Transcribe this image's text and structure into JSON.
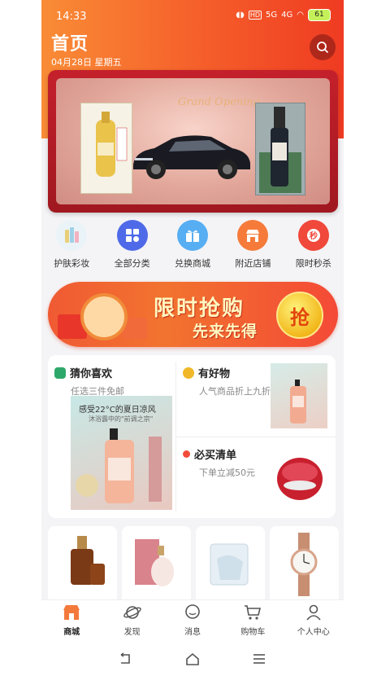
{
  "status": {
    "time": "14:33",
    "hd": "HD",
    "signal1": "5G",
    "signal2": "4G",
    "battery": "61"
  },
  "header": {
    "title": "首页",
    "date": "04月28日 星期五"
  },
  "banner": {
    "script": "Grand Opening"
  },
  "categories": [
    {
      "label": "护肤彩妆",
      "icon": "cosmetics-icon",
      "color": "#dff0f7"
    },
    {
      "label": "全部分类",
      "icon": "grid-icon",
      "color": "#4f6ae8"
    },
    {
      "label": "兑换商城",
      "icon": "gift-icon",
      "color": "#58aef2"
    },
    {
      "label": "附近店铺",
      "icon": "store-icon",
      "color": "#f67b3a"
    },
    {
      "label": "限时秒杀",
      "icon": "flash-sale-icon",
      "color": "#f0483b"
    }
  ],
  "flash_banner": {
    "line1": "限时抢购",
    "line2": "先来先得",
    "coin": "抢"
  },
  "recommend": {
    "guess": {
      "title": "猜你喜欢",
      "sub": "任选三件免邮",
      "caption": "感受22°C的夏日凉风",
      "caption2": "沐浴露中的\"前调之宗\""
    },
    "good": {
      "title": "有好物",
      "sub": "人气商品折上九折"
    },
    "must": {
      "title": "必买清单",
      "sub": "下单立减50元"
    }
  },
  "tabbar": [
    {
      "label": "商城",
      "icon": "mall-icon",
      "active": true
    },
    {
      "label": "发现",
      "icon": "planet-icon",
      "active": false
    },
    {
      "label": "消息",
      "icon": "message-icon",
      "active": false
    },
    {
      "label": "购物车",
      "icon": "cart-icon",
      "active": false
    },
    {
      "label": "个人中心",
      "icon": "user-icon",
      "active": false
    }
  ],
  "colors": {
    "accent": "#f6652c",
    "brand_red": "#c4202b"
  }
}
